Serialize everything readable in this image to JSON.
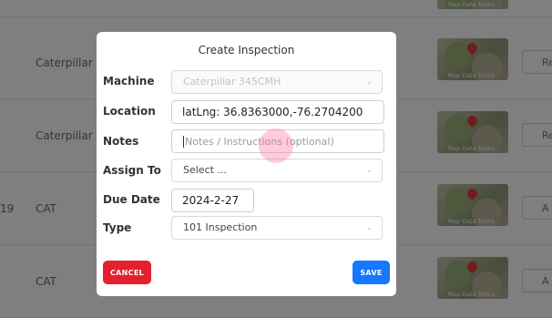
{
  "background": {
    "rows": [
      {
        "col1": "",
        "col2": "",
        "button": ""
      },
      {
        "col1": "",
        "col2": "Caterpillar",
        "button": "Re"
      },
      {
        "col1": "",
        "col2": "Caterpillar",
        "button": "Re"
      },
      {
        "col1": "19",
        "col2": "CAT",
        "button": "A"
      },
      {
        "col1": "",
        "col2": "CAT",
        "button": "A"
      }
    ],
    "map_footer": "Map Data  Terms"
  },
  "modal": {
    "title": "Create Inspection",
    "fields": {
      "machine": {
        "label": "Machine",
        "value": "Caterpillar 345CMH"
      },
      "location": {
        "label": "Location",
        "value": "latLng: 36.8363000,-76.2704200"
      },
      "notes": {
        "label": "Notes",
        "placeholder": "Notes / Instructions (optional)"
      },
      "assign_to": {
        "label": "Assign To",
        "value": "Select ..."
      },
      "due_date": {
        "label": "Due Date",
        "value": "2024-2-27"
      },
      "type": {
        "label": "Type",
        "value": "101 Inspection"
      }
    },
    "cancel_label": "CANCEL",
    "save_label": "SAVE"
  },
  "colors": {
    "cancel": "#e5202e",
    "save": "#1677ff",
    "overlay": "rgba(0,0,0,0.5)"
  },
  "icons": {
    "select_chevron": "chevron-down-icon",
    "map_pin": "map-pin-icon"
  }
}
